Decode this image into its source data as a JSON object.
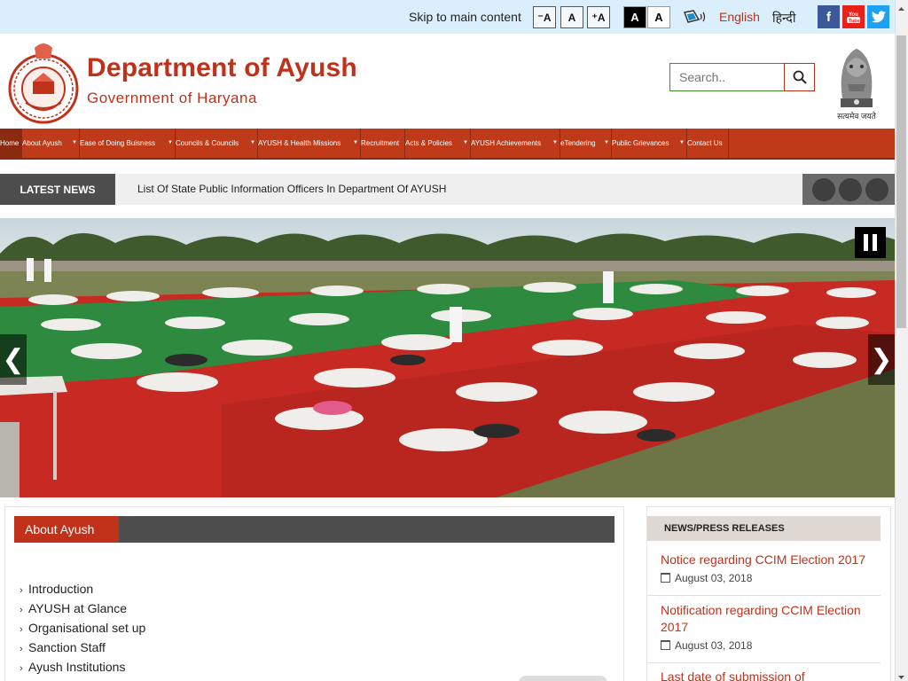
{
  "topbar": {
    "skip_link": "Skip to main content",
    "font_decrease": "⁻A",
    "font_normal": "A",
    "font_increase": "⁺A",
    "contrast_dark": "A",
    "contrast_light": "A",
    "lang_english": "English",
    "lang_hindi": "हिन्दी",
    "social": {
      "facebook": "f",
      "youtube": "▶",
      "twitter": "t"
    }
  },
  "header": {
    "title": "Department of Ayush",
    "subtitle": "Government of Haryana",
    "search_placeholder": "Search..",
    "emblem_motto": "सत्यमेव जयते"
  },
  "nav": {
    "items": [
      {
        "label": "Home",
        "dropdown": false
      },
      {
        "label": "About Ayush",
        "dropdown": true
      },
      {
        "label": "Ease of Doing Buisness",
        "dropdown": true
      },
      {
        "label": "Councils & Councils",
        "dropdown": true
      },
      {
        "label": "AYUSH & Health Missions",
        "dropdown": true
      },
      {
        "label": "Recruitment",
        "dropdown": false
      },
      {
        "label": "Acts & Policies",
        "dropdown": true
      },
      {
        "label": "AYUSH Achievements",
        "dropdown": true
      },
      {
        "label": "eTendering",
        "dropdown": true
      },
      {
        "label": "Public Grievances",
        "dropdown": true
      },
      {
        "label": "Contact Us",
        "dropdown": false
      }
    ]
  },
  "news": {
    "label": "LATEST NEWS",
    "headline": "List Of State Public Information Officers In Department Of AYUSH"
  },
  "slider": {
    "prev": "❮",
    "next": "❯"
  },
  "about": {
    "heading": "About Ayush",
    "links": [
      "Introduction",
      "AYUSH at Glance",
      "Organisational set up",
      "Sanction Staff",
      "Ayush Institutions"
    ]
  },
  "press": {
    "heading": "NEWS/PRESS RELEASES",
    "items": [
      {
        "title": "Notice regarding CCIM Election 2017",
        "date": "August 03, 2018"
      },
      {
        "title": "Notification regarding CCIM Election 2017",
        "date": "August 03, 2018"
      },
      {
        "title": "Last date of submission of",
        "date": ""
      }
    ]
  },
  "colors": {
    "brand_red": "#c0311a",
    "nav_bg": "#bf3a18",
    "topbar_bg": "#dbeefb",
    "dark_gray": "#4d4d4d"
  }
}
